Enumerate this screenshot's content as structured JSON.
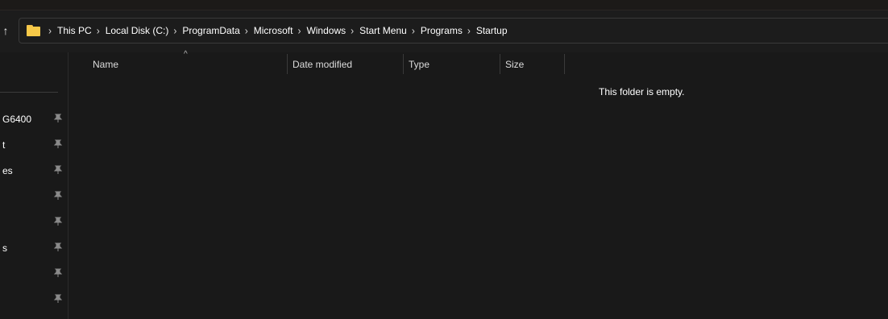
{
  "toolbar": {
    "up_glyph": "↑"
  },
  "address": {
    "folder_icon": "folder-icon",
    "separator": "›",
    "crumbs": [
      "This PC",
      "Local Disk (C:)",
      "ProgramData",
      "Microsoft",
      "Windows",
      "Start Menu",
      "Programs",
      "Startup"
    ]
  },
  "nav": {
    "items": [
      {
        "label": "G6400",
        "icon": "pin-icon"
      },
      {
        "label": "t",
        "icon": "pin-icon"
      },
      {
        "label": "es",
        "icon": "pin-icon"
      },
      {
        "label": "",
        "icon": "pin-icon"
      },
      {
        "label": "",
        "icon": "pin-icon"
      },
      {
        "label": "s",
        "icon": "pin-icon"
      },
      {
        "label": "",
        "icon": "pin-icon"
      },
      {
        "label": "",
        "icon": "pin-icon"
      }
    ]
  },
  "columns": {
    "sort_glyph": "^",
    "name": "Name",
    "date_modified": "Date modified",
    "type": "Type",
    "size": "Size"
  },
  "content": {
    "empty_message": "This folder is empty."
  },
  "colors": {
    "background": "#191919",
    "folder": "#f7c948",
    "text": "#ffffff"
  }
}
